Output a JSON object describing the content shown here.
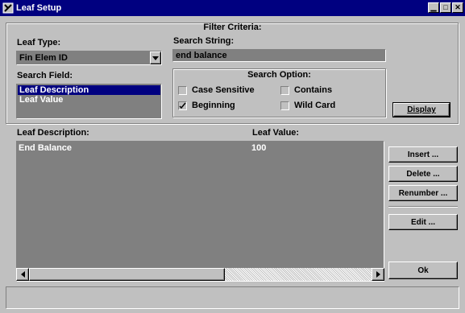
{
  "window": {
    "title": "Leaf Setup"
  },
  "filter": {
    "title": "Filter Criteria:",
    "leaf_type_label": "Leaf Type:",
    "leaf_type_value": "Fin Elem ID",
    "search_string_label": "Search String:",
    "search_string_value": "end balance",
    "search_field_label": "Search Field:",
    "search_field_items": [
      "Leaf Description",
      "Leaf Value"
    ],
    "search_field_selected": 0,
    "search_option_title": "Search Option:",
    "options": {
      "case_sensitive": {
        "label": "Case Sensitive",
        "checked": false
      },
      "contains": {
        "label": "Contains",
        "checked": false
      },
      "beginning": {
        "label": "Beginning",
        "checked": true
      },
      "wild_card": {
        "label": "Wild Card",
        "checked": false
      }
    },
    "display_button": "Display"
  },
  "grid": {
    "col_description": "Leaf Description:",
    "col_value": "Leaf Value:",
    "rows": [
      {
        "description": "End Balance",
        "value": "100"
      }
    ]
  },
  "buttons": {
    "insert": "Insert ...",
    "delete": "Delete ...",
    "renumber": "Renumber ...",
    "edit": "Edit ...",
    "ok": "Ok"
  },
  "colors": {
    "titlebar": "#000080",
    "face": "#c0c0c0",
    "dark_field": "#808080",
    "selection": "#000080"
  }
}
